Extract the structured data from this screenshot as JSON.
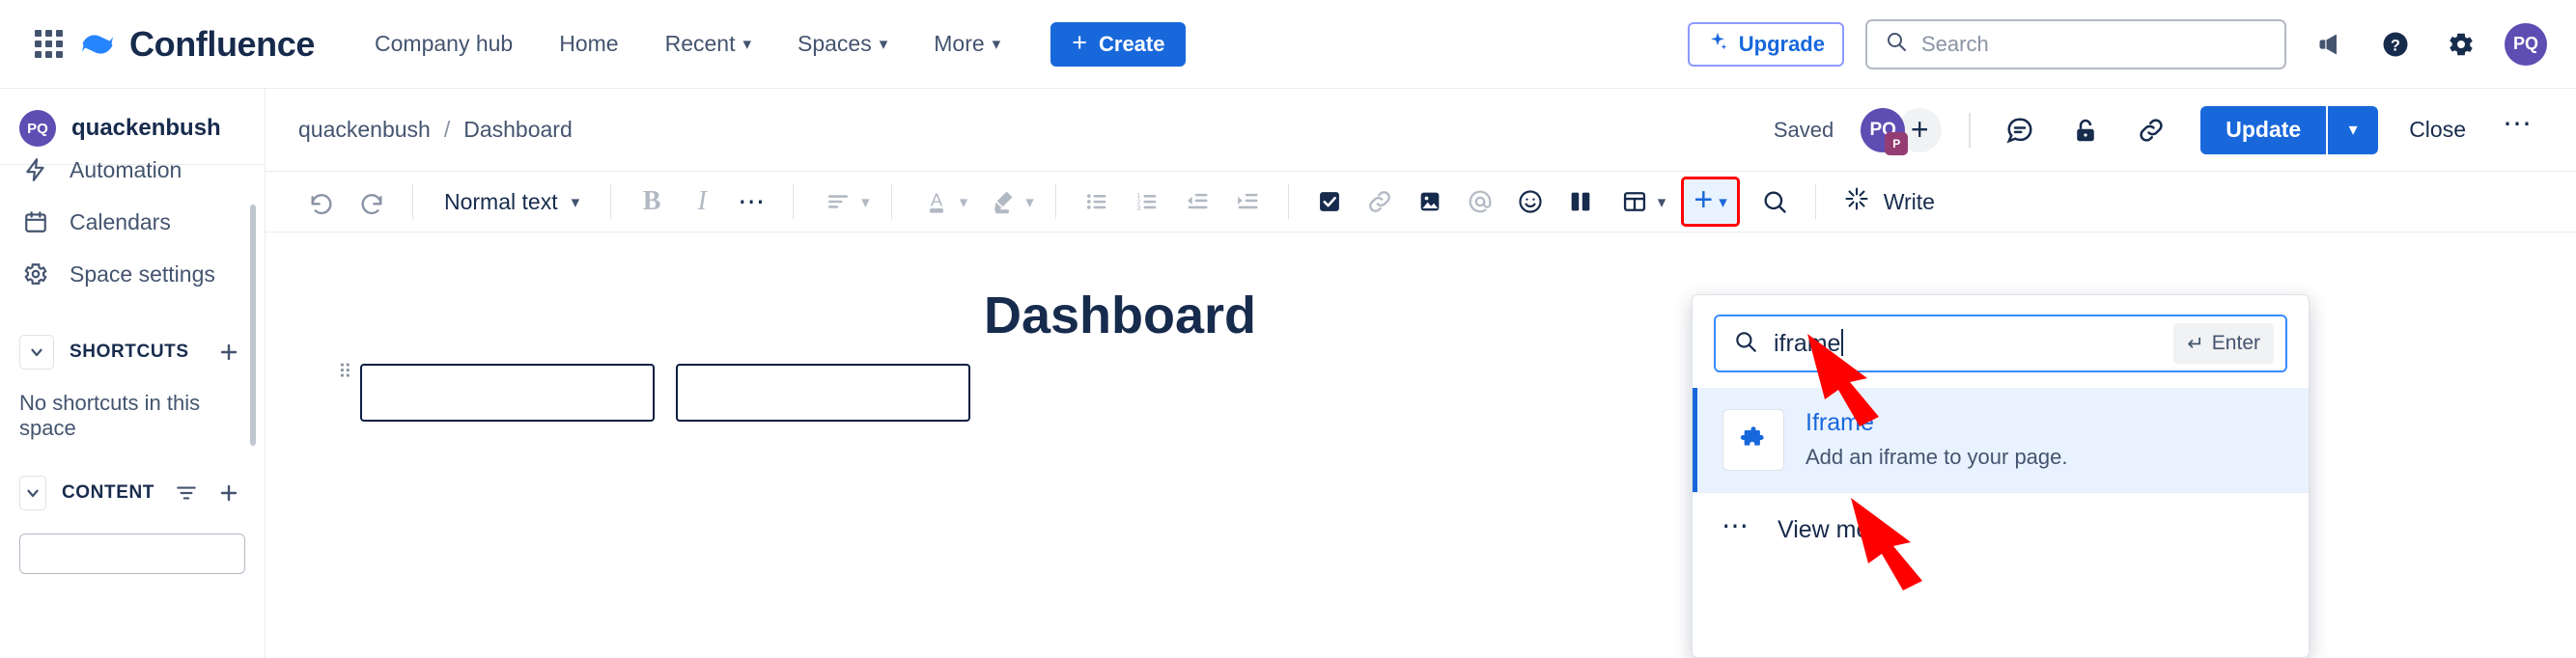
{
  "topnav": {
    "app_switcher_icon": "grid-apps-icon",
    "brand": "Confluence",
    "links": [
      {
        "label": "Company hub",
        "has_caret": false
      },
      {
        "label": "Home",
        "has_caret": false
      },
      {
        "label": "Recent",
        "has_caret": true
      },
      {
        "label": "Spaces",
        "has_caret": true
      },
      {
        "label": "More",
        "has_caret": true
      }
    ],
    "create_label": "Create",
    "upgrade_label": "Upgrade",
    "search_placeholder": "Search",
    "icons": [
      "megaphone-icon",
      "help-icon",
      "settings-gear-icon"
    ],
    "avatar_initials": "PQ"
  },
  "sidebar": {
    "space_name": "quackenbush",
    "space_avatar_initials": "PQ",
    "items": [
      {
        "label": "Automation",
        "icon": "bolt-icon"
      },
      {
        "label": "Calendars",
        "icon": "calendar-icon"
      },
      {
        "label": "Space settings",
        "icon": "gear-icon"
      }
    ],
    "shortcuts": {
      "label": "SHORTCUTS",
      "empty_text": "No shortcuts in this space",
      "add_icon": "plus-icon",
      "chevron_icon": "chevron-down-icon"
    },
    "content": {
      "label": "CONTENT",
      "filter_icon": "filter-icon",
      "add_icon": "plus-icon",
      "chevron_icon": "chevron-down-icon"
    }
  },
  "page_header": {
    "breadcrumb": [
      "quackenbush",
      "Dashboard"
    ],
    "breadcrumb_separator": "/",
    "status": "Saved",
    "collaborator_initials": "PQ",
    "collaborator_badge": "P",
    "add_collaborator_icon": "plus-icon",
    "action_icons": [
      "comment-icon",
      "restrictions-lock-icon",
      "copy-link-icon"
    ],
    "update_label": "Update",
    "update_caret_icon": "chevron-down-icon",
    "close_label": "Close",
    "more_icon": "more-options-icon"
  },
  "toolbar": {
    "undo_icon": "undo-icon",
    "redo_icon": "redo-icon",
    "text_style": "Normal text",
    "bold_label": "B",
    "italic_label": "I",
    "more_formatting_icon": "ellipsis-icon",
    "align_icon": "text-align-icon",
    "text_color_icon": "text-color-icon",
    "highlight_icon": "highlight-icon",
    "bullet_list_icon": "bullet-list-icon",
    "numbered_list_icon": "numbered-list-icon",
    "outdent_icon": "outdent-icon",
    "indent_icon": "indent-icon",
    "task_icon": "checkbox-task-icon",
    "link_icon": "link-icon",
    "image_icon": "image-icon",
    "mention_icon": "mention-at-icon",
    "emoji_icon": "emoji-icon",
    "layout_icon": "layouts-icon",
    "table_icon": "table-icon",
    "table_caret_icon": "chevron-down-icon",
    "insert_icon": "plus-icon",
    "insert_caret_icon": "chevron-down-icon",
    "find_icon": "search-icon",
    "write_label": "Write",
    "write_icon": "ai-sparkle-icon",
    "highlight_color": "#FF0000"
  },
  "canvas": {
    "document_title": "Dashboard",
    "drag_handle_icon": "drag-handle-icon"
  },
  "insert_panel": {
    "search_icon": "search-icon",
    "search_value": "iframe",
    "enter_hint": "Enter",
    "enter_icon": "enter-return-icon",
    "results": [
      {
        "title": "Iframe",
        "description": "Add an iframe to your page.",
        "icon": "puzzle-piece-icon",
        "selected": true
      }
    ],
    "view_more_label": "View more",
    "view_more_icon": "ellipsis-icon"
  },
  "annotations": {
    "arrow_color": "#FF0000",
    "arrows": [
      "points-to-search-input",
      "points-to-iframe-result"
    ]
  }
}
